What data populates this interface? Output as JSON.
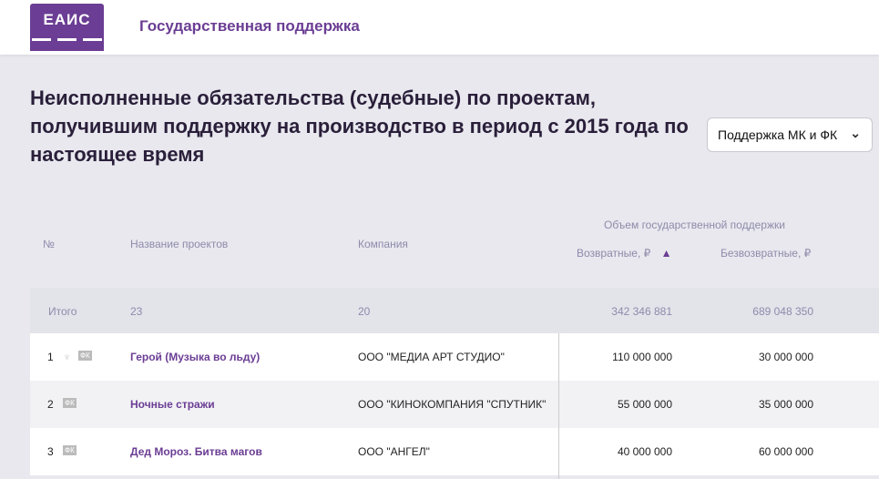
{
  "header": {
    "logo_text": "ЕАИС",
    "brand": "Государственная поддержка"
  },
  "page": {
    "title": "Неисполненные обязательства (судебные) по проектам, получившим поддержку на производство в период с 2015 года по настоящее время",
    "filter": "Поддержка МК и ФК"
  },
  "table": {
    "headers": {
      "num": "№",
      "name": "Название проектов",
      "company": "Компания",
      "group": "Объем государственной поддержки",
      "returnable": "Возвратные, ₽",
      "nonreturnable": "Безвозвратные, ₽"
    },
    "total": {
      "label": "Итого",
      "projects": "23",
      "companies": "20",
      "returnable": "342 346 881",
      "nonreturnable": "689 048 350"
    },
    "badge": "ФК",
    "rows": [
      {
        "num": "1",
        "name": "Герой (Музыка во льду)",
        "company": "ООО \"МЕДИА АРТ СТУДИО\"",
        "returnable": "110 000 000",
        "nonreturnable": "30 000 000"
      },
      {
        "num": "2",
        "name": "Ночные стражи",
        "company": "ООО \"КИНОКОМПАНИЯ \"СПУТНИК\"",
        "returnable": "55 000 000",
        "nonreturnable": "35 000 000"
      },
      {
        "num": "3",
        "name": "Дед Мороз. Битва магов",
        "company": "ООО \"АНГЕЛ\"",
        "returnable": "40 000 000",
        "nonreturnable": "60 000 000"
      }
    ]
  }
}
